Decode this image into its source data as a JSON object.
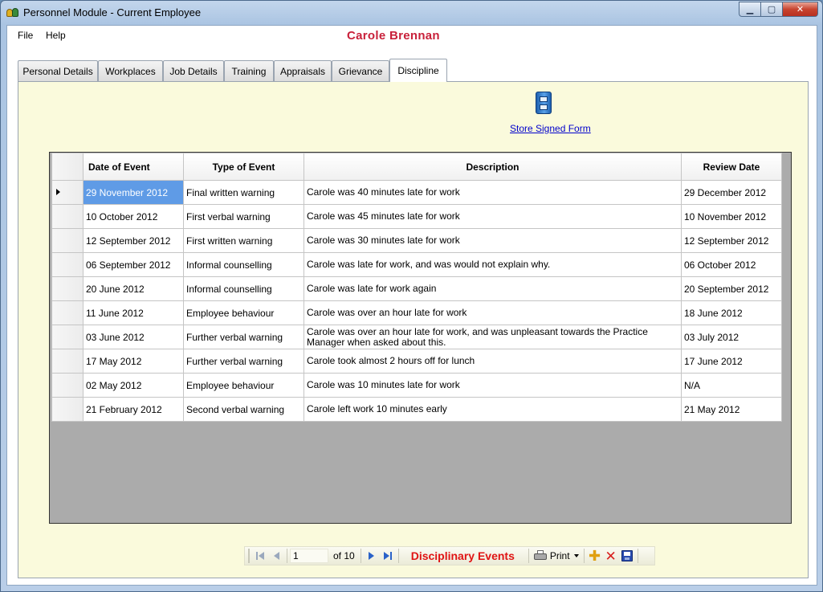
{
  "window": {
    "title": "Personnel Module - Current Employee",
    "minimize_label": "▁",
    "maximize_label": "▢",
    "close_label": "✕"
  },
  "menu": {
    "file": "File",
    "help": "Help"
  },
  "employee_name": "Carole Brennan",
  "tabs": [
    {
      "label": "Personal Details"
    },
    {
      "label": "Workplaces"
    },
    {
      "label": "Job Details"
    },
    {
      "label": "Training"
    },
    {
      "label": "Appraisals"
    },
    {
      "label": "Grievance"
    },
    {
      "label": "Discipline"
    }
  ],
  "active_tab": "Discipline",
  "store_link": "Store Signed Form",
  "grid": {
    "columns": {
      "date": "Date of Event",
      "type": "Type of Event",
      "description": "Description",
      "review": "Review Date"
    },
    "rows": [
      {
        "date": "29 November 2012",
        "type": "Final written warning",
        "description": "Carole was 40 minutes late for work",
        "review": "29 December 2012"
      },
      {
        "date": "10 October 2012",
        "type": "First verbal warning",
        "description": "Carole was 45 minutes late for work",
        "review": "10 November 2012"
      },
      {
        "date": "12 September 2012",
        "type": "First written warning",
        "description": "Carole was 30 minutes late for work",
        "review": "12 September 2012"
      },
      {
        "date": "06 September 2012",
        "type": "Informal counselling",
        "description": "Carole was late for work, and was would not explain why.",
        "review": "06 October 2012"
      },
      {
        "date": "20 June 2012",
        "type": "Informal counselling",
        "description": "Carole was late for work again",
        "review": "20 September 2012"
      },
      {
        "date": "11 June 2012",
        "type": "Employee behaviour",
        "description": "Carole was over an hour late for work",
        "review": "18 June 2012"
      },
      {
        "date": "03 June 2012",
        "type": "Further verbal warning",
        "description": "Carole was over an hour late for work, and was unpleasant towards the Practice Manager when asked about this.",
        "review": "03 July 2012"
      },
      {
        "date": "17 May 2012",
        "type": "Further verbal warning",
        "description": "Carole took almost 2 hours off for lunch",
        "review": "17 June 2012"
      },
      {
        "date": "02 May 2012",
        "type": "Employee behaviour",
        "description": "Carole was 10 minutes late for work",
        "review": "N/A"
      },
      {
        "date": "21 February 2012",
        "type": "Second verbal warning",
        "description": "Carole left work 10 minutes early",
        "review": "21 May 2012"
      }
    ]
  },
  "navigator": {
    "position": "1",
    "of_text": "of 10",
    "title": "Disciplinary Events",
    "print_label": "Print"
  },
  "icons": {
    "store": "file-cabinet-icon",
    "first": "first-record-icon",
    "prev": "previous-record-icon",
    "next": "next-record-icon",
    "last": "last-record-icon",
    "print": "printer-icon",
    "add": "plus-icon",
    "delete": "delete-icon",
    "save": "save-icon"
  },
  "colors": {
    "employee_name": "#c8203a",
    "panel_bg": "#fafadc",
    "selected_cell": "#5f9be6",
    "nav_title": "#e01414",
    "link": "#0000cc"
  }
}
